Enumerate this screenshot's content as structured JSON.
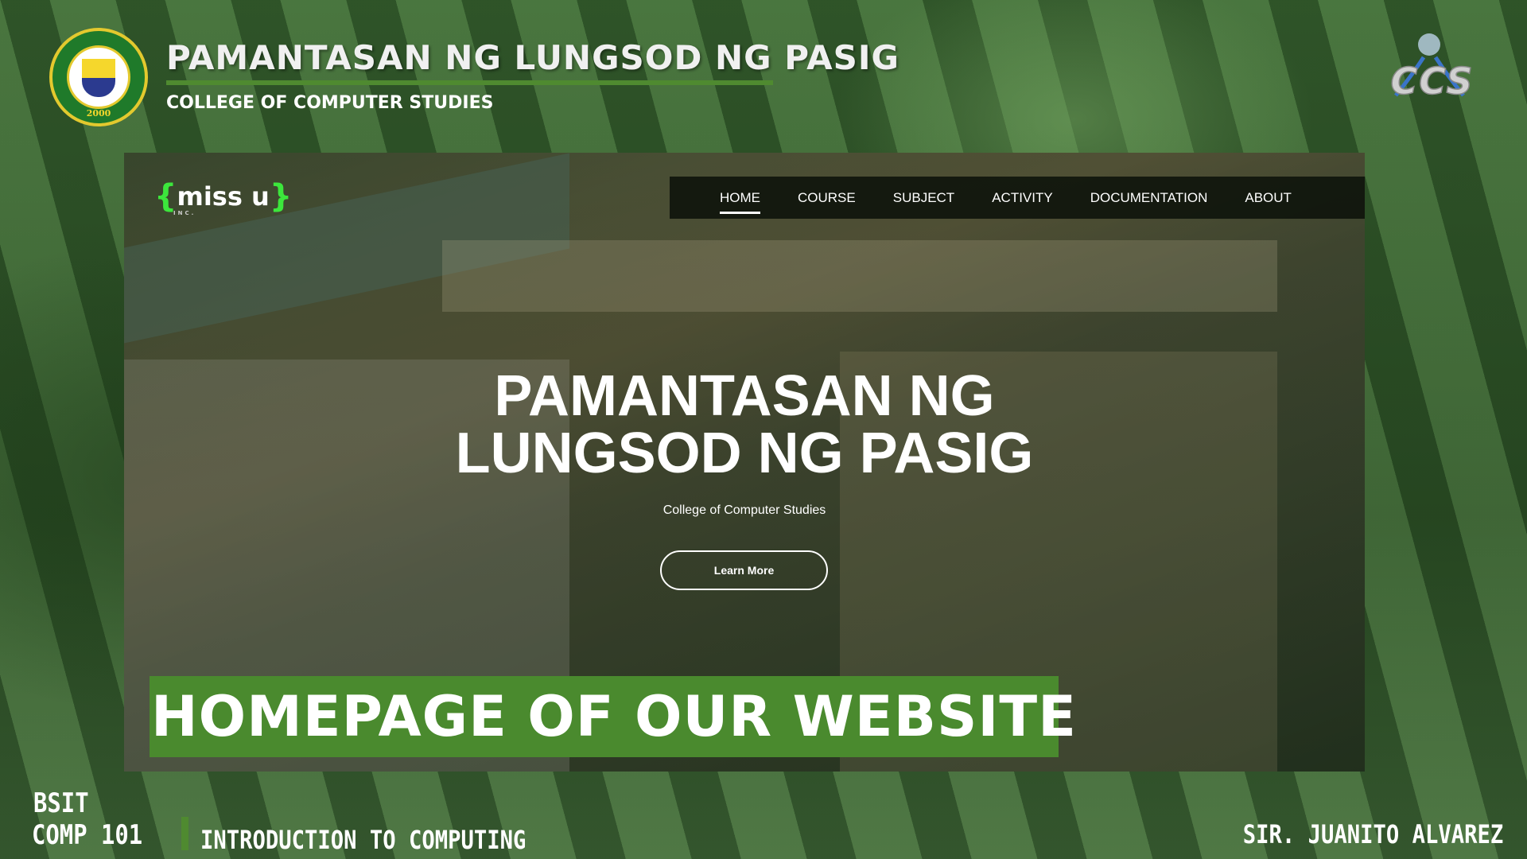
{
  "header": {
    "title": "PAMANTASAN NG LUNGSOD NG PASIG",
    "subtitle": "COLLEGE OF COMPUTER STUDIES",
    "seal_year": "2000",
    "seal_text": "PAMANTASAN NG LUNGSOD NG PASIG",
    "ccs_logo_text": "CCS"
  },
  "website": {
    "logo": {
      "text": "miss u",
      "suffix": "INC."
    },
    "nav": [
      {
        "label": "HOME",
        "active": true
      },
      {
        "label": "COURSE"
      },
      {
        "label": "SUBJECT"
      },
      {
        "label": "ACTIVITY"
      },
      {
        "label": "DOCUMENTATION"
      },
      {
        "label": "ABOUT"
      }
    ],
    "hero_line1": "PAMANTASAN NG",
    "hero_line2": "LUNGSOD NG PASIG",
    "hero_sub": "College of Computer Studies",
    "cta": "Learn More"
  },
  "banner": "HOMEPAGE OF OUR WEBSITE",
  "footer": {
    "program": "BSIT",
    "course_code": "COMP 101",
    "course_title": "INTRODUCTION TO COMPUTING",
    "instructor": "SIR. JUANITO ALVAREZ"
  },
  "colors": {
    "accent_green": "#4a8a2e",
    "nav_bg": "#0c120a"
  }
}
